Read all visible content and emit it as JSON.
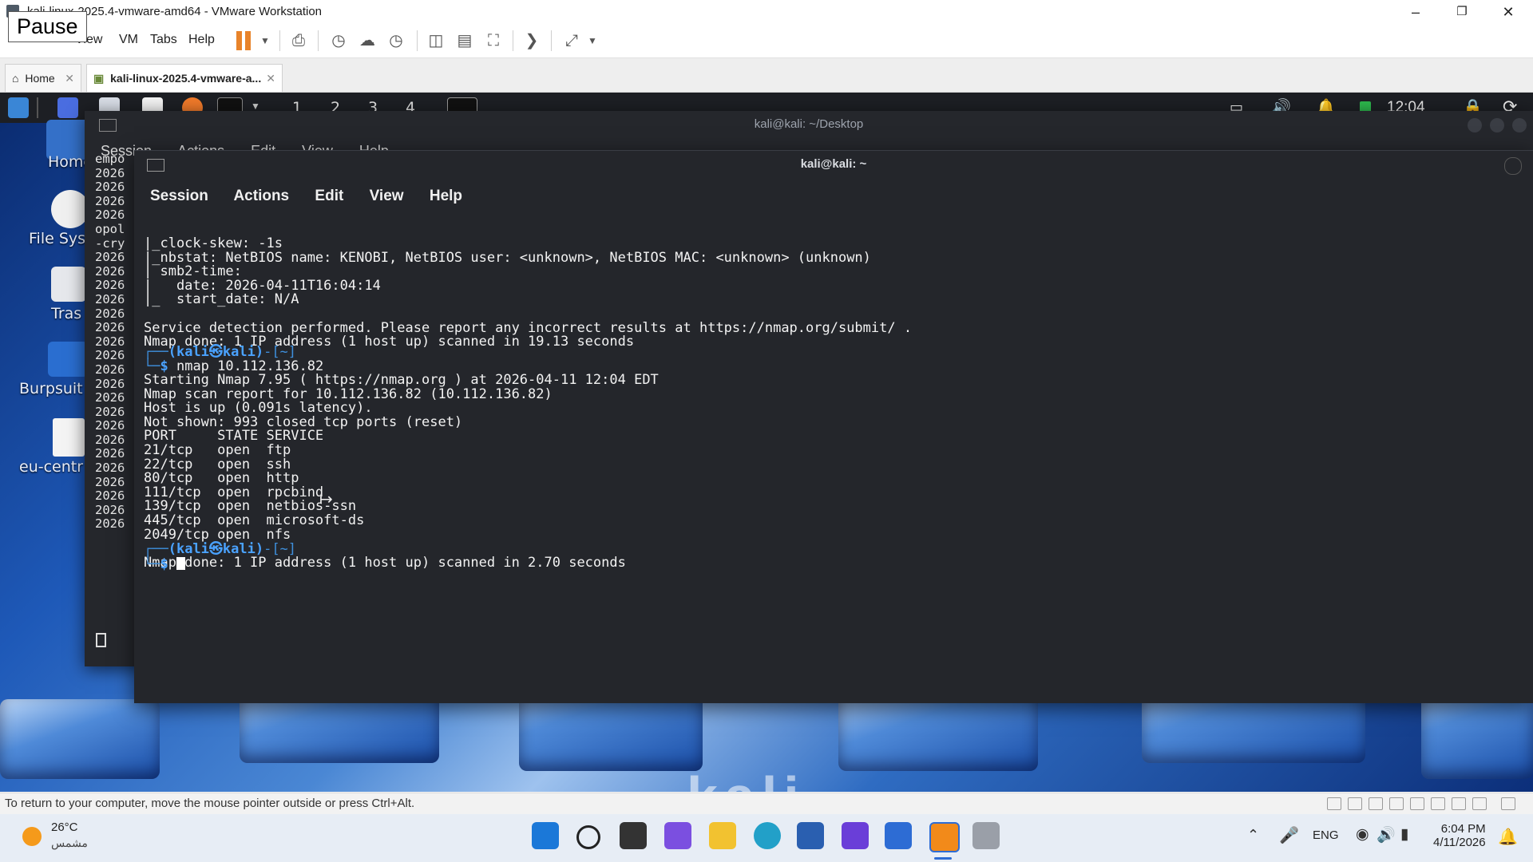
{
  "vm": {
    "window_title": "kali-linux-2025.4-vmware-amd64 - VMware Workstation",
    "pause_tooltip": "Pause",
    "menu": [
      "View",
      "VM",
      "Tabs",
      "Help"
    ],
    "tabs": [
      {
        "label": "Home"
      },
      {
        "label": "kali-linux-2025.4-vmware-a..."
      }
    ],
    "status_text": "To return to your computer, move the mouse pointer outside or press Ctrl+Alt."
  },
  "kali_panel": {
    "workspaces": [
      "1",
      "2",
      "3",
      "4"
    ],
    "clock": "12:04"
  },
  "desktop_icons": [
    {
      "label": "Home"
    },
    {
      "label": "File Sys"
    },
    {
      "label": "Tras"
    },
    {
      "label": "Burpsuit"
    },
    {
      "label": "eu-centr"
    }
  ],
  "desktop_watermark": "kali",
  "term_back": {
    "title": "kali@kali: ~/Desktop",
    "menu": [
      "Session",
      "Actions",
      "Edit",
      "View",
      "Help"
    ],
    "lines": [
      "empo",
      "2026",
      "2026",
      "2026",
      "2026",
      "opol",
      "-cry",
      "2026",
      "2026",
      "2026",
      "2026",
      "2026",
      "2026",
      "2026",
      "2026",
      "2026",
      "2026",
      "2026",
      "2026",
      "2026",
      "2026",
      "2026",
      "2026",
      "2026",
      "2026",
      "2026",
      "2026"
    ]
  },
  "term_front": {
    "title": "kali@kali: ~",
    "menu": [
      "Session",
      "Actions",
      "Edit",
      "View",
      "Help"
    ],
    "output1": "|_clock-skew: -1s\n|_nbstat: NetBIOS name: KENOBI, NetBIOS user: <unknown>, NetBIOS MAC: <unknown> (unknown)\n| smb2-time:\n|   date: 2026-04-11T16:04:14\n|_  start_date: N/A\n\nService detection performed. Please report any incorrect results at https://nmap.org/submit/ .\nNmap done: 1 IP address (1 host up) scanned in 19.13 seconds\n",
    "prompt_user": "(kali㉿kali)",
    "prompt_path": "-[~]",
    "command": "nmap 10.112.136.82",
    "output2": "Starting Nmap 7.95 ( https://nmap.org ) at 2026-04-11 12:04 EDT\nNmap scan report for 10.112.136.82 (10.112.136.82)\nHost is up (0.091s latency).\nNot shown: 993 closed tcp ports (reset)\nPORT     STATE SERVICE\n21/tcp   open  ftp\n22/tcp   open  ssh\n80/tcp   open  http\n111/tcp  open  rpcbind\n139/tcp  open  netbios-ssn\n445/tcp  open  microsoft-ds\n2049/tcp open  nfs\n\nNmap done: 1 IP address (1 host up) scanned in 2.70 seconds\n"
  },
  "taskbar": {
    "weather_temp": "26°C",
    "weather_desc": "مشمس",
    "language": "ENG",
    "time": "6:04 PM",
    "date": "4/11/2026"
  },
  "colors": {
    "prompt_blue": "#4aa2ff",
    "terminal_bg": "#24262b",
    "pause_orange": "#e8832a"
  }
}
